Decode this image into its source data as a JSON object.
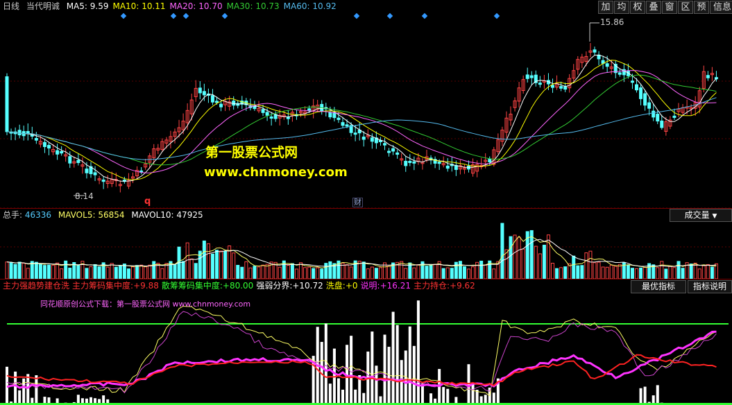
{
  "price_panel": {
    "period_label": "日线",
    "stock_name": "当代明诚",
    "ma": [
      {
        "label": "MA5:",
        "value": "9.59",
        "color": "#ffffff"
      },
      {
        "label": "MA10:",
        "value": "10.11",
        "color": "#ffff00"
      },
      {
        "label": "MA20:",
        "value": "10.70",
        "color": "#ff66ff"
      },
      {
        "label": "MA30:",
        "value": "10.73",
        "color": "#33cc33"
      },
      {
        "label": "MA60:",
        "value": "10.92",
        "color": "#55bbee"
      }
    ],
    "high_label": "15.86",
    "low_label": "8.14",
    "marker_q": "q",
    "marker_cai": "财",
    "watermark_title": "第一股票公式网",
    "watermark_url": "www.chnmoney.com"
  },
  "toolbar": {
    "buttons": [
      "加",
      "均",
      "权",
      "叠",
      "窗",
      "区",
      "预",
      "信息",
      "▼"
    ]
  },
  "volume_panel": {
    "label": "总手:",
    "value": "46336",
    "mavol5_label": "MAVOL5:",
    "mavol5_value": "56854",
    "mavol10_label": "MAVOL10:",
    "mavol10_value": "47925",
    "selector": "成交量"
  },
  "indicator_panel": {
    "items": [
      {
        "label": "主力强趋势建仓洗",
        "value": "",
        "color": "#ff3333"
      },
      {
        "label": "主力筹码集中度:",
        "value": "+9.88",
        "color": "#ff3333"
      },
      {
        "label": "散筹筹码集中度:",
        "value": "+80.00",
        "color": "#33ff33"
      },
      {
        "label": "强弱分界:",
        "value": "+10.72",
        "color": "#ffffff"
      },
      {
        "label": "洗盘:",
        "value": "+0",
        "color": "#ffff00"
      },
      {
        "label": "说明:",
        "value": "+16.21",
        "color": "#ff33ff"
      },
      {
        "label": "主力持仓:",
        "value": "+9.62",
        "color": "#ff3333"
      }
    ],
    "best_button": "最优指标",
    "explain_button": "指标说明",
    "note": "同花顺原创公式下载：第一股票公式网 www.chnmoney.com"
  },
  "colors": {
    "up": "#ff4444",
    "down": "#55ffff",
    "border": "#7a0000"
  }
}
